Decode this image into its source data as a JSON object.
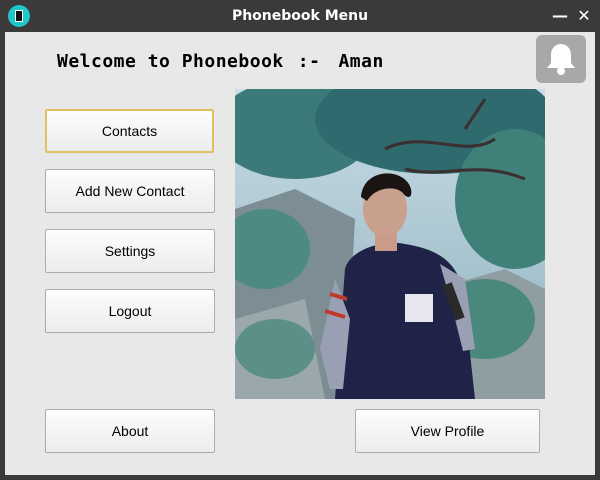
{
  "window": {
    "title": "Phonebook Menu",
    "minimize_glyph": "—",
    "close_glyph": "✕"
  },
  "header": {
    "welcome_text": "Welcome to Phonebook",
    "separator": ":-",
    "username": "Aman"
  },
  "notification": {
    "icon": "bell-icon"
  },
  "menu": {
    "contacts_label": "Contacts",
    "add_contact_label": "Add New Contact",
    "settings_label": "Settings",
    "logout_label": "Logout",
    "about_label": "About",
    "view_profile_label": "View Profile"
  },
  "profile_photo": {
    "description": "profile-photo"
  },
  "colors": {
    "titlebar": "#3a3a3a",
    "content_bg": "#e8e8e8",
    "app_icon": "#1ec8c8",
    "bell_bg": "#a8a8a8",
    "focus_border": "#e0c060"
  }
}
